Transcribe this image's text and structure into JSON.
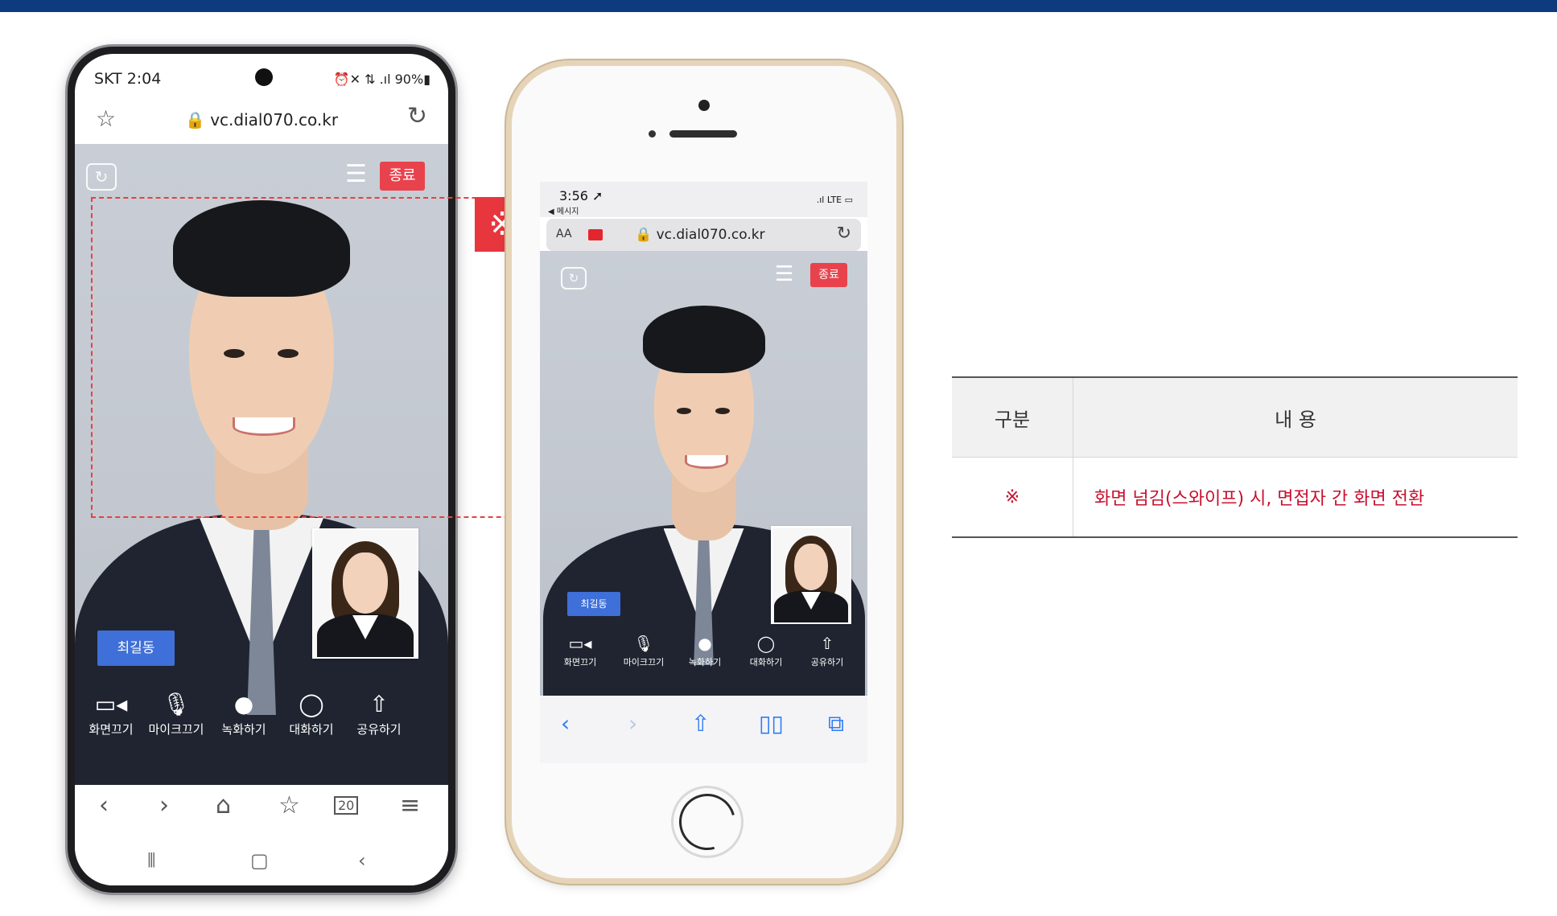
{
  "android": {
    "status_time": "SKT 2:04",
    "status_icons": "⏰✕ ⇅ .ıl 90%▮",
    "url": "🔒 vc.dial070.co.kr",
    "end_label": "종료",
    "name_tag": "최길동",
    "controls": [
      "화면끄기",
      "마이크끄기",
      "녹화하기",
      "대화하기",
      "공유하기"
    ],
    "tabs_count": "20"
  },
  "marker_symbol": "※",
  "iphone": {
    "status_time": "3:56 ➚",
    "back_label": "◀ 메시지",
    "signal": ".ıl LTE ▭",
    "aa_label": "AA",
    "url": "🔒 vc.dial070.co.kr",
    "end_label": "종료",
    "name_tag": "최길동",
    "controls": [
      "화면끄기",
      "마이크끄기",
      "녹화하기",
      "대화하기",
      "공유하기"
    ]
  },
  "table": {
    "headers": [
      "구분",
      "내 용"
    ],
    "rows": [
      {
        "category": "※",
        "content": "화면 넘김(스와이프) 시, 면접자 간 화면 전환"
      }
    ]
  },
  "colors": {
    "top_bar": "#0d3b7d",
    "end_button": "#e8434d",
    "name_tag": "#3f6fd8",
    "accent_red": "#c8102e",
    "ios_blue": "#2f7bf5"
  }
}
